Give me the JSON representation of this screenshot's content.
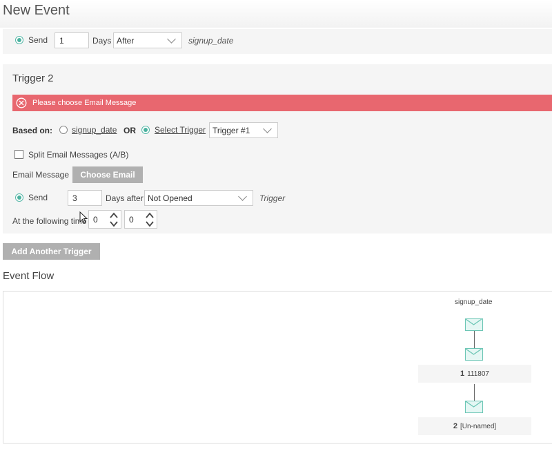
{
  "page": {
    "title": "New Event"
  },
  "send_row": {
    "send_label": "Send",
    "days_value": "1",
    "days_label": "Days",
    "direction_selected": "After",
    "reference": "signup_date"
  },
  "trigger": {
    "heading": "Trigger 2",
    "alert": "Please choose Email Message",
    "based_on_label": "Based on:",
    "option_signup": "signup_date",
    "or_label": "OR",
    "option_select": "Select Trigger",
    "trigger_selected": "Trigger #1",
    "split_label": "Split Email Messages (A/B)",
    "email_message_label": "Email Message",
    "choose_email": "Choose Email",
    "send_label": "Send",
    "days_value": "3",
    "days_after_label": "Days after",
    "condition_selected": "Not Opened",
    "trigger_ref": "Trigger",
    "time_label": "At the following time",
    "hour_value": "0",
    "minute_value": "0"
  },
  "add_trigger": "Add Another Trigger",
  "event_flow": {
    "heading": "Event Flow",
    "root_label": "signup_date",
    "nodes": [
      {
        "num": "1",
        "name": "111807"
      },
      {
        "num": "2",
        "name": "[Un-named]"
      }
    ]
  },
  "colors": {
    "accent": "#4bb29f",
    "alert": "#e8676f",
    "button": "#b0b0b0"
  }
}
